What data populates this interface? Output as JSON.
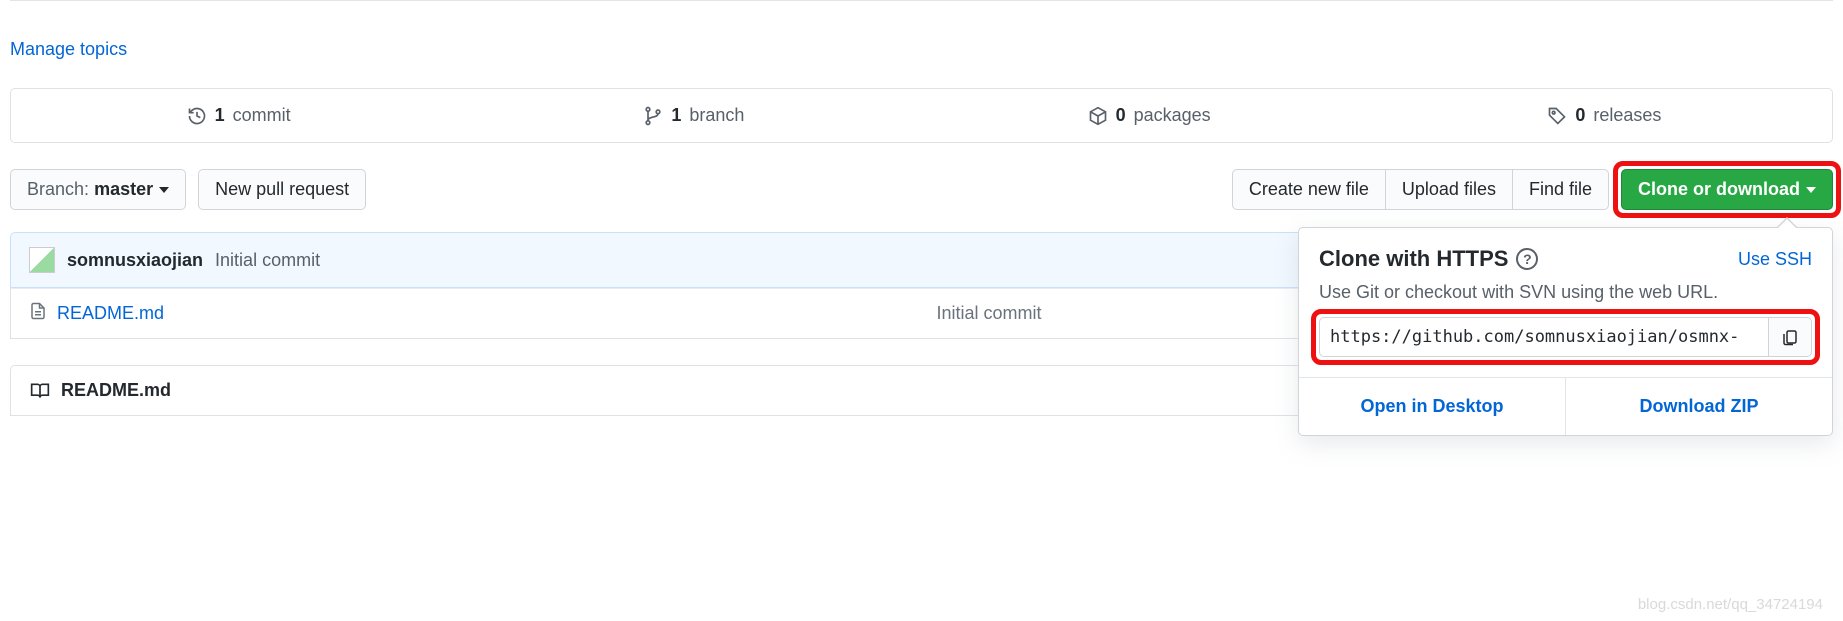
{
  "topics": {
    "manage_label": "Manage topics"
  },
  "summary": {
    "commits": {
      "count": "1",
      "label": "commit"
    },
    "branches": {
      "count": "1",
      "label": "branch"
    },
    "packages": {
      "count": "0",
      "label": "packages"
    },
    "releases": {
      "count": "0",
      "label": "releases"
    }
  },
  "actions": {
    "branch_prefix": "Branch:",
    "branch_name": "master",
    "new_pr": "New pull request",
    "create_file": "Create new file",
    "upload_files": "Upload files",
    "find_file": "Find file",
    "clone": "Clone or download"
  },
  "commit": {
    "author": "somnusxiaojian",
    "message": "Initial commit"
  },
  "files": [
    {
      "name": "README.md",
      "msg": "Initial commit"
    }
  ],
  "readme": {
    "title": "README.md"
  },
  "clone_popup": {
    "title": "Clone with HTTPS",
    "use_ssh": "Use SSH",
    "desc": "Use Git or checkout with SVN using the web URL.",
    "url": "https://github.com/somnusxiaojian/osmnx-",
    "open_desktop": "Open in Desktop",
    "download_zip": "Download ZIP"
  },
  "watermark": "blog.csdn.net/qq_34724194"
}
